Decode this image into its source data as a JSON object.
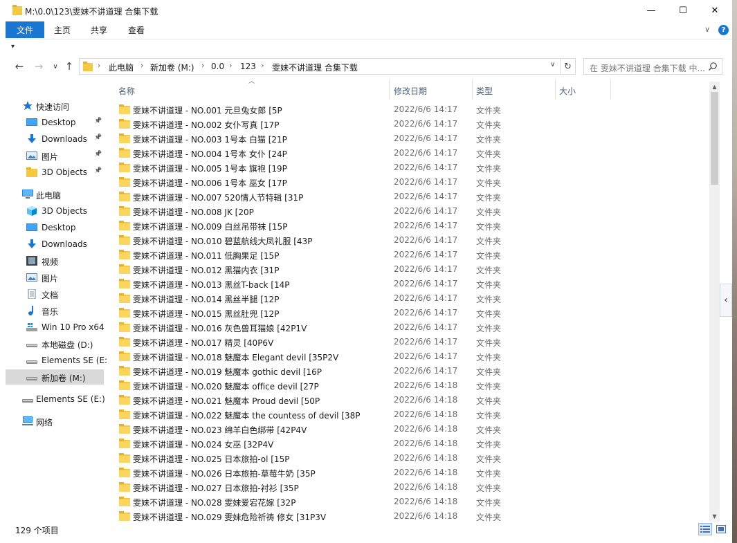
{
  "window": {
    "title": "M:\\0.0\\123\\雯妹不讲道理 合集下载",
    "minimize": "—",
    "maximize": "☐",
    "close": "✕"
  },
  "ribbon": {
    "tabs": [
      "文件",
      "主页",
      "共享",
      "查看"
    ],
    "expand": "∨",
    "help": "?"
  },
  "quick_access_toolbar": "▾",
  "nav": {
    "back": "←",
    "forward": "→",
    "recent": "∨",
    "up": "↑"
  },
  "address": {
    "crumbs": [
      "此电脑",
      "新加卷 (M:)",
      "0.0",
      "123",
      "雯妹不讲道理 合集下载"
    ],
    "dropdown": "∨",
    "refresh": "↻"
  },
  "search": {
    "placeholder": "在 雯妹不讲道理 合集下载 中..."
  },
  "sidebar": {
    "items": [
      {
        "label": "快速访问",
        "icon": "star-icon",
        "pinned": false
      },
      {
        "label": "Desktop",
        "icon": "desktop-icon",
        "pinned": true
      },
      {
        "label": "Downloads",
        "icon": "download-icon",
        "pinned": true
      },
      {
        "label": "图片",
        "icon": "pictures-icon",
        "pinned": true
      },
      {
        "label": "3D Objects",
        "icon": "folder-icon",
        "pinned": true
      },
      {
        "label": "此电脑",
        "icon": "computer-icon",
        "pinned": false
      },
      {
        "label": "3D Objects",
        "icon": "cube-icon",
        "pinned": false
      },
      {
        "label": "Desktop",
        "icon": "desktop-icon",
        "pinned": false
      },
      {
        "label": "Downloads",
        "icon": "download-icon",
        "pinned": false
      },
      {
        "label": "视频",
        "icon": "video-icon",
        "pinned": false
      },
      {
        "label": "图片",
        "icon": "pictures-icon",
        "pinned": false
      },
      {
        "label": "文档",
        "icon": "document-icon",
        "pinned": false
      },
      {
        "label": "音乐",
        "icon": "music-icon",
        "pinned": false
      },
      {
        "label": "Win 10 Pro x64",
        "icon": "os-drive-icon",
        "pinned": false
      },
      {
        "label": "本地磁盘 (D:)",
        "icon": "drive-icon",
        "pinned": false
      },
      {
        "label": "Elements SE (E:",
        "icon": "drive-icon",
        "pinned": false
      },
      {
        "label": "新加卷 (M:)",
        "icon": "drive-icon",
        "pinned": false,
        "selected": true
      },
      {
        "label": "Elements SE (E:)",
        "icon": "drive-icon",
        "pinned": false
      },
      {
        "label": "网络",
        "icon": "network-icon",
        "pinned": false
      }
    ]
  },
  "columns": {
    "name": "名称",
    "modified": "修改日期",
    "type": "类型",
    "size": "大小"
  },
  "files": [
    {
      "name": "雯妹不讲道理 - NO.001 元旦兔女郎 [5P",
      "date": "2022/6/6 14:17",
      "type": "文件夹"
    },
    {
      "name": "雯妹不讲道理 - NO.002 女仆写真 [17P",
      "date": "2022/6/6 14:17",
      "type": "文件夹"
    },
    {
      "name": "雯妹不讲道理 - NO.003 1号本 白猫 [21P",
      "date": "2022/6/6 14:17",
      "type": "文件夹"
    },
    {
      "name": "雯妹不讲道理 - NO.004 1号本 女仆 [24P",
      "date": "2022/6/6 14:17",
      "type": "文件夹"
    },
    {
      "name": "雯妹不讲道理 - NO.005 1号本 旗袍 [19P",
      "date": "2022/6/6 14:17",
      "type": "文件夹"
    },
    {
      "name": "雯妹不讲道理 - NO.006 1号本 巫女 [17P",
      "date": "2022/6/6 14:17",
      "type": "文件夹"
    },
    {
      "name": "雯妹不讲道理 - NO.007 520情人节特辑 [31P",
      "date": "2022/6/6 14:17",
      "type": "文件夹"
    },
    {
      "name": "雯妹不讲道理 - NO.008 JK [20P",
      "date": "2022/6/6 14:17",
      "type": "文件夹"
    },
    {
      "name": "雯妹不讲道理 - NO.009 白丝吊带袜 [15P",
      "date": "2022/6/6 14:17",
      "type": "文件夹"
    },
    {
      "name": "雯妹不讲道理 - NO.010 碧蓝航线大凤礼服 [43P",
      "date": "2022/6/6 14:17",
      "type": "文件夹"
    },
    {
      "name": "雯妹不讲道理 - NO.011 低胸果足 [15P",
      "date": "2022/6/6 14:17",
      "type": "文件夹"
    },
    {
      "name": "雯妹不讲道理 - NO.012 黑猫内衣 [31P",
      "date": "2022/6/6 14:17",
      "type": "文件夹"
    },
    {
      "name": "雯妹不讲道理 - NO.013 黑丝T-back [14P",
      "date": "2022/6/6 14:17",
      "type": "文件夹"
    },
    {
      "name": "雯妹不讲道理 - NO.014 黑丝半腿 [12P",
      "date": "2022/6/6 14:17",
      "type": "文件夹"
    },
    {
      "name": "雯妹不讲道理 - NO.015 黑丝肚兜 [12P",
      "date": "2022/6/6 14:17",
      "type": "文件夹"
    },
    {
      "name": "雯妹不讲道理 - NO.016 灰色兽耳猫娘 [42P1V",
      "date": "2022/6/6 14:17",
      "type": "文件夹"
    },
    {
      "name": "雯妹不讲道理 - NO.017 精灵 [40P6V",
      "date": "2022/6/6 14:17",
      "type": "文件夹"
    },
    {
      "name": "雯妹不讲道理 - NO.018 魅魔本 Elegant devil [35P2V",
      "date": "2022/6/6 14:17",
      "type": "文件夹"
    },
    {
      "name": "雯妹不讲道理 - NO.019 魅魔本 gothic devil [16P",
      "date": "2022/6/6 14:17",
      "type": "文件夹"
    },
    {
      "name": "雯妹不讲道理 - NO.020 魅魔本 office devil [27P",
      "date": "2022/6/6 14:18",
      "type": "文件夹"
    },
    {
      "name": "雯妹不讲道理 - NO.021 魅魔本 Proud devil [50P",
      "date": "2022/6/6 14:18",
      "type": "文件夹"
    },
    {
      "name": "雯妹不讲道理 - NO.022 魅魔本 the countess of devil [38P",
      "date": "2022/6/6 14:18",
      "type": "文件夹"
    },
    {
      "name": "雯妹不讲道理 - NO.023 绵羊白色绑带 [42P4V",
      "date": "2022/6/6 14:18",
      "type": "文件夹"
    },
    {
      "name": "雯妹不讲道理 - NO.024 女巫 [32P4V",
      "date": "2022/6/6 14:18",
      "type": "文件夹"
    },
    {
      "name": "雯妹不讲道理 - NO.025 日本旅拍-ol [15P",
      "date": "2022/6/6 14:18",
      "type": "文件夹"
    },
    {
      "name": "雯妹不讲道理 - NO.026 日本旅拍-草莓牛奶 [35P",
      "date": "2022/6/6 14:18",
      "type": "文件夹"
    },
    {
      "name": "雯妹不讲道理 - NO.027 日本旅拍-衬衫 [35P",
      "date": "2022/6/6 14:18",
      "type": "文件夹"
    },
    {
      "name": "雯妹不讲道理 - NO.028 雯妹爱宕花嫁 [32P",
      "date": "2022/6/6 14:18",
      "type": "文件夹"
    },
    {
      "name": "雯妹不讲道理 - NO.029 雯妹危险祈祷 修女 [31P3V",
      "date": "2022/6/6 14:18",
      "type": "文件夹"
    }
  ],
  "status": {
    "item_count": "129 个项目"
  },
  "scrollbar": {
    "up": "▲",
    "down": "▼"
  },
  "side_tab": "‹",
  "colors": {
    "accent": "#1976d2",
    "folder": "#f5c842",
    "selection": "#d9d9d9"
  }
}
